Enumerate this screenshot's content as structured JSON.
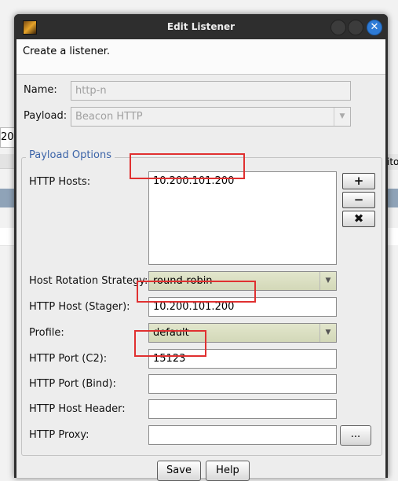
{
  "background": {
    "left_input_fragment": "20(",
    "right_tab_fragment": "ito"
  },
  "window": {
    "title": "Edit Listener",
    "close_glyph": "✕"
  },
  "description": "Create a listener.",
  "form": {
    "name": {
      "label": "Name:",
      "value": "http-n"
    },
    "payload": {
      "label": "Payload:",
      "value": "Beacon HTTP"
    },
    "group_title": "Payload Options",
    "http_hosts": {
      "label": "HTTP Hosts:",
      "items": [
        "10.200.101.200"
      ]
    },
    "host_buttons": {
      "add": "+",
      "remove": "−",
      "clear": "✖"
    },
    "rotation": {
      "label": "Host Rotation Strategy:",
      "value": "round-robin"
    },
    "stager_host": {
      "label": "HTTP Host (Stager):",
      "value": "10.200.101.200"
    },
    "profile": {
      "label": "Profile:",
      "value": "default"
    },
    "port_c2": {
      "label": "HTTP Port (C2):",
      "value": "15123"
    },
    "port_bind": {
      "label": "HTTP Port (Bind):",
      "value": ""
    },
    "host_header": {
      "label": "HTTP Host Header:",
      "value": ""
    },
    "proxy": {
      "label": "HTTP Proxy:",
      "value": "",
      "button": "..."
    }
  },
  "buttons": {
    "save": "Save",
    "help": "Help"
  },
  "colors": {
    "highlight_box": "#e03030",
    "group_title": "#3c64a8",
    "title_bar": "#2e2e2e",
    "close_button": "#2e7bd6"
  }
}
